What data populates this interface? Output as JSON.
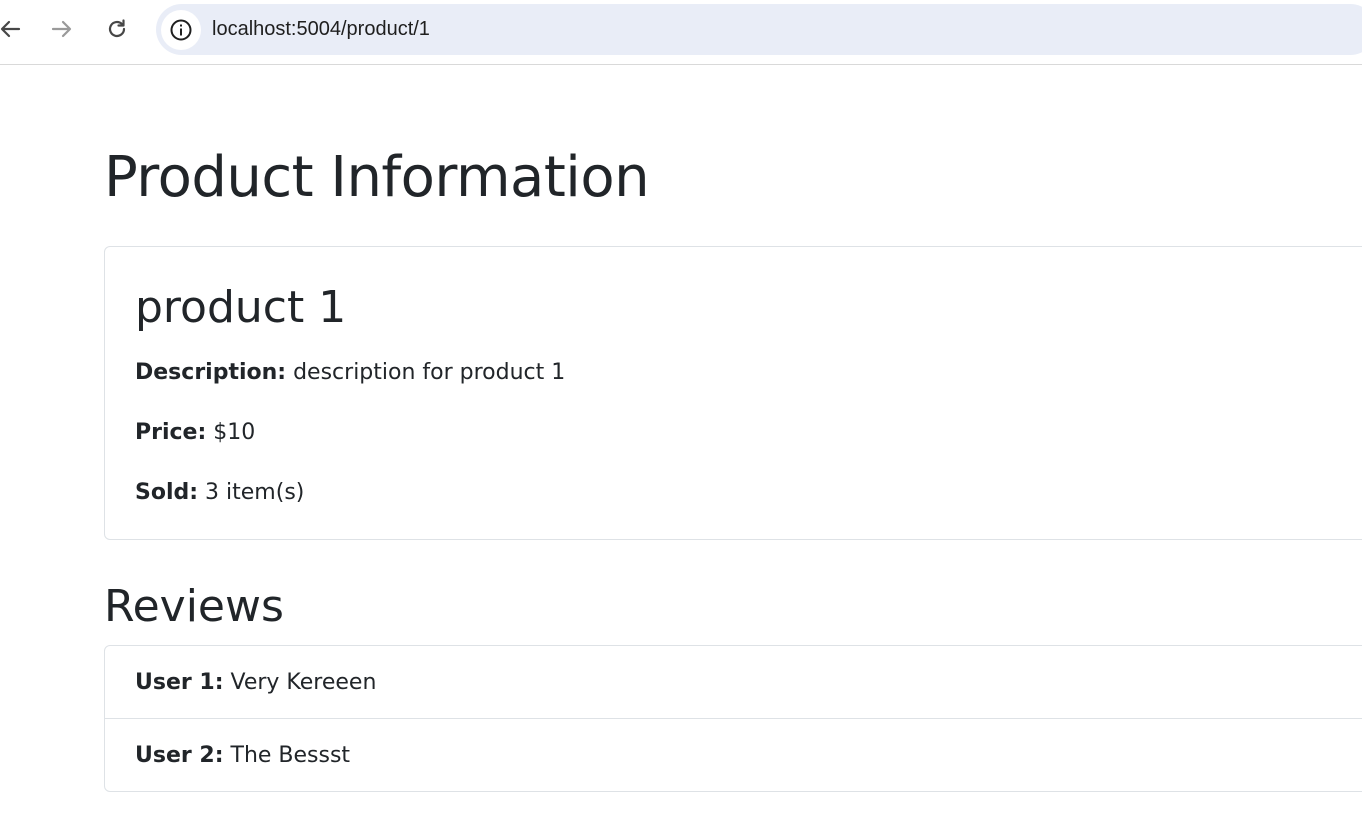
{
  "browser": {
    "url": "localhost:5004/product/1",
    "icons": {
      "back": "arrow-left-icon",
      "forward": "arrow-right-icon",
      "reload": "reload-icon",
      "site_info": "info-icon"
    }
  },
  "page": {
    "title": "Product Information"
  },
  "product": {
    "name": "product 1",
    "description_label": "Description:",
    "description_value": "description for product 1",
    "price_label": "Price:",
    "price_value": "$10",
    "sold_label": "Sold:",
    "sold_value": "3 item(s)"
  },
  "reviews": {
    "heading": "Reviews",
    "items": [
      {
        "user": "User 1:",
        "text": "Very Kereeen"
      },
      {
        "user": "User 2:",
        "text": "The Bessst"
      }
    ]
  },
  "colors": {
    "text": "#212529",
    "border": "#dee2e6",
    "omnibox": "#e9edf7"
  }
}
